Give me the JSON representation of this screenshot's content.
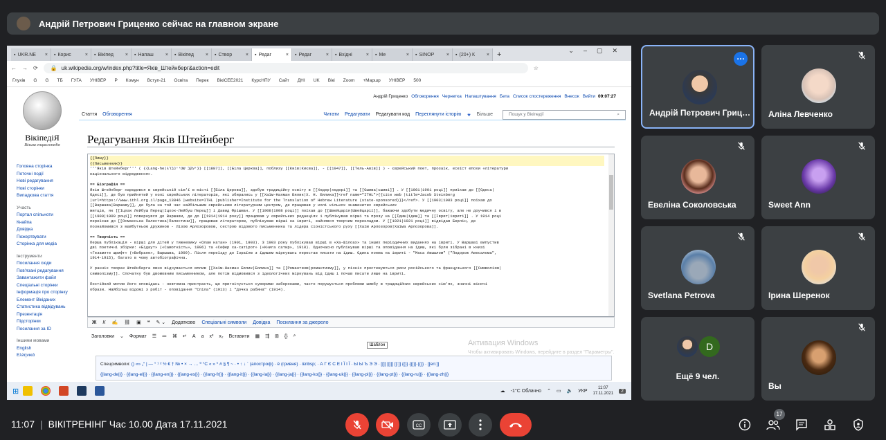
{
  "banner": {
    "text": "Андрій Петрович Гриценко сейчас на главном экране"
  },
  "browser": {
    "tabs": [
      "UKR.NE",
      "Корис",
      "Вікіпед",
      "Напаш",
      "Вікіпед",
      "Створ",
      "Редаг",
      "Редаг",
      "Вхідні",
      "Ме",
      "SINOP",
      "(20+) К"
    ],
    "url": "uk.wikipedia.org/w/index.php?title=Яків_Штейнберг&action=edit",
    "bookmarks": [
      "Глухів",
      "G",
      "G",
      "ТБ",
      "ГУГА",
      "УНІВЕР",
      "Р",
      "Комун",
      "Вступ-21",
      "Освіта",
      "Перек",
      "ВікіСЕЕ2021",
      "КурсНПУ",
      "Сайт",
      "ДНІ",
      "UK",
      "Вікі",
      "Zoom",
      "+Маршр",
      "УНІВЕР",
      "500"
    ]
  },
  "wiki": {
    "logo_title": "ВікіпедіЯ",
    "logo_sub": "Вільна енциклопедія",
    "personal": [
      "Андрій Гриценко",
      "Обговорення",
      "Чернетка",
      "Налаштування",
      "Бета",
      "Список спостереження",
      "Внесок",
      "Вийти"
    ],
    "time": "09:07:27",
    "nav_main": [
      "Головна сторінка",
      "Поточні події",
      "Нові редагування",
      "Нові сторінки",
      "Випадкова стаття"
    ],
    "nav_part_head": "Участь",
    "nav_part": [
      "Портал спільноти",
      "Кнайпа",
      "Довідка",
      "Пожертвувати",
      "Сторінка для медіа"
    ],
    "nav_tools_head": "Інструменти",
    "nav_tools": [
      "Посилання сюди",
      "Пов'язані редагування",
      "Завантажити файл",
      "Спеціальні сторінки",
      "Інформація про сторінку",
      "Елемент Вікіданих",
      "Статистика відвідувань",
      "Презентація",
      "Підсторінки",
      "Посилання за ID"
    ],
    "nav_lang_head": "Іншими мовами",
    "nav_lang": [
      "English",
      "Ελληνικά"
    ],
    "tab_article": "Стаття",
    "tab_talk": "Обговорення",
    "tab_read": "Читати",
    "tab_edit": "Редагувати",
    "tab_editcode": "Редагувати код",
    "tab_history": "Переглянути історію",
    "tab_more": "Більше",
    "search_placeholder": "Пошук у Вікіпедії",
    "title": "Редагування Яків Штейнберг",
    "editor_lines": [
      "{{Пишу}}",
      "{{Письменник}}",
      "'''Яків Штейнберг''' ( {{Lang-he|יעקב שטיינברג}} [[1887]], [[Біла Церква]], поблизу [[Київ|Києва]], - [[1947]], [[Тель-Авів]] ) - єврейський поет, прозаїк, есеїст епохи «літератури",
      "національного відродження».",
      "",
      "== Біографія ==",
      "Яків Штейнберг народився в єврейській сім'ї в місті [[Біла Церква]], здобув традиційну освіту в [[Хедер|хедері]] та [[Єшива|єшиві]] . У [[1901|1901 році]] приїхав до [[Одеса|",
      "Одесі]], де був прийнятий у колі єврейських літераторів, які збирались у [[Хаїм-Нахман Бялик|Х. Н. Бялика]]<ref name=\"ITHL\">{{cite web |title=Jacob Steinberg",
      "|url=https://www.ithl.org.il/page_13846 |website=ITHL |publisher=Institute for the Translation of Hebrew Literature (state-sponsored)}}</ref>. У [[1903|1903 році]] поїхав до",
      "[[Варшава|Варшаву]], де була на той час найбільшим єврейським літературним центром, де працював у колі кількох знаменитих єврейських",
      "митців, як [[Іцхак Лейбуш Перец|Іцхок-Лейбуш Перец]] і Давид Фрішман. У [[1908|1908 році]] поїхав до [[Швейцарія|Швейцарії]], бажаючи здобути медичну освіту, але не доучився і в",
      "[[1909|1909 році]] повернувся до Варшави, де до [[1914|1914 року]] працював у єврейських редакціях і публікував вірші та прозу на [[Їдиш|їдиш]] та [[Іврит|івриті]] . У 1914 році",
      "переїхав до [[Османська Палестина|Палестини]], працював літератором, публікував вірші на івриті, зайнявся творчим перекладом. У [[1921|1921 році]] відвідав Берлін, де",
      "познайомився з майбутньою дружиною - Лізою Арлозоровою, сестрою відомого письменника та лідера сіоністського руху [[Хаїм Арлозоров|Хаїма Арлозорова]].",
      "",
      "== Творчість ==",
      "Перша публікація - вірші для дітей у тижневику «Олам катан» (1901, 1903). З 1903 року публікував вірші в «Ха-Шілоах» та інших періодичних виданнях на івриті. У Варшаві випустив",
      "дві поетичні збірки: «Бідаут» («Самотність», 1906) та «Сефер ха-сатірот» («Книга сатир», 1910). Одночасно публікував вірші та оповідання на їдиш, які були зібрані в книзі",
      "«Гезамлте шрифт» («Вибране», Варшава, 1909). Після переїзду до Ізраїлю з їдишем міркувань перестав писати на їдиш. Єдина поема на івриті - \"Маса Авшалом\" (\"Подорож Авесалома\",",
      "1914-1915), багато в чому автобіографічна.",
      "",
      "У ранніх творах Штейнберга явно відчувається вплив [[Хаїм-Нахман Бялик|Бялика]] та [[Романтизм|романтизму]], у пізніх простежуються риси російського та французького [[Символізм|",
      "символізму]]. Спочатку був двомовним письменником, але потім відмовився з ідеологічних міркувань від їдиш і почав писати лише на івриті.",
      "",
      "Постійний мотив його оповідань - невтомна пристрасть, що пригнічується суворими заборонами, часто порушується проблеми шлюбу в традиційних єврейських сім'ях, значні жіночі",
      "образи. Найбільш відомі з робіт - оповідання \"Спіла\" (1913) і \"Дочка рабина\" (1914)."
    ],
    "toolbar1": [
      "Додатково",
      "Спеціальні символи",
      "Довідка",
      "Посилання за джерело"
    ],
    "toolbar2": [
      "Заголовки",
      "Формат",
      "Вставити"
    ],
    "tooltip": "Шаблон",
    "special_label": "Спецсимволи:",
    "special_row1": "() «» „“ | — ° ¹ ² ½ € † № • × → … ⁰ °C « » * # § ¶ ~ · • ↑ ↓ ´ (апостроф) · ё (гривня) · &nbsp; · А Г Є С Е І Ї І Ї · Ы Ы Ъ Э Э · [[]] [[|]] [[:]] {{}} {{|}} {{}} · [[en:]]",
    "special_row2": "{{lang-de|}} · {{lang-el|}} · {{lang-en|}} · {{lang-es|}} · {{lang-fr|}} · {{lang-it|}} · {{lang-la|}} · {{lang-ja|}} · {{lang-ko|}} · {{lang-uk|}} · {{lang-pl|}} · {{lang-pt|}} · {{lang-ru|}} · {{lang-zh|}}"
  },
  "windows_watermark": {
    "title": "Активация Windows",
    "sub": "Чтобы активировать Windows, перейдите в раздел \"Параметры\"."
  },
  "taskbar": {
    "weather": "-1°C Облачно",
    "lang": "УКР",
    "time": "11:07",
    "date": "17.11.2021",
    "notif": "2"
  },
  "participants": [
    {
      "name": "Андрій Петрович Гриц…",
      "selected": true
    },
    {
      "name": "Аліна Левченко"
    },
    {
      "name": "Евеліна Соколовська"
    },
    {
      "name": "Sweet Ann"
    },
    {
      "name": "Svetlana Petrova"
    },
    {
      "name": "Ірина Шеренок"
    },
    {
      "name": "Ещё 9 чел.",
      "avatar_letter": "D"
    },
    {
      "name": "Вы"
    }
  ],
  "meeting": {
    "time": "11:07",
    "title": "ВІКІТРЕНІНГ Час 10.00 Дата 17.11.2021",
    "participant_count": "17"
  },
  "colors": {
    "accent": "#1a73e8",
    "danger": "#ea4335",
    "tile": "#3c4043",
    "bg": "#202124"
  }
}
